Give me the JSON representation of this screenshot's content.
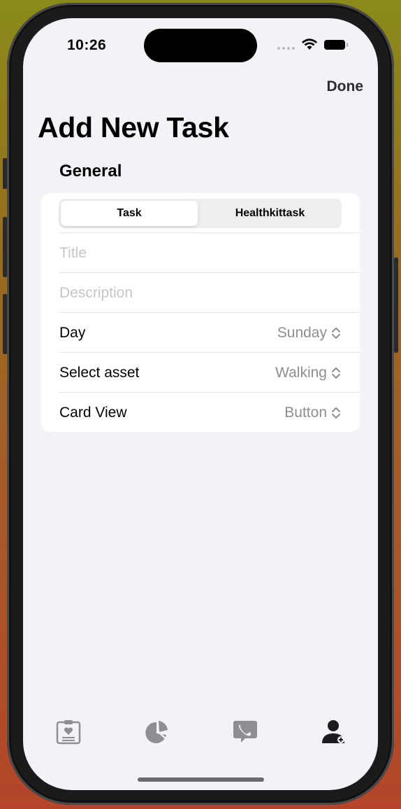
{
  "status_bar": {
    "time": "10:26"
  },
  "nav": {
    "done_label": "Done"
  },
  "page": {
    "title": "Add New Task"
  },
  "section": {
    "title": "General"
  },
  "segmented": {
    "options": [
      "Task",
      "Healthkittask"
    ],
    "selected": "Task"
  },
  "fields": {
    "title_placeholder": "Title",
    "description_placeholder": "Description"
  },
  "pickers": [
    {
      "label": "Day",
      "value": "Sunday"
    },
    {
      "label": "Select asset",
      "value": "Walking"
    },
    {
      "label": "Card View",
      "value": "Button"
    }
  ],
  "tabbar": {
    "icons": [
      "care-plan-icon",
      "insights-pie-icon",
      "contact-phone-icon",
      "profile-add-icon"
    ],
    "selected_index": 3
  },
  "colors": {
    "background": "#f2f2f7",
    "inactive_icon": "#8e8e93",
    "active_icon": "#1c1c1e",
    "secondary_text": "#8e8e93"
  }
}
